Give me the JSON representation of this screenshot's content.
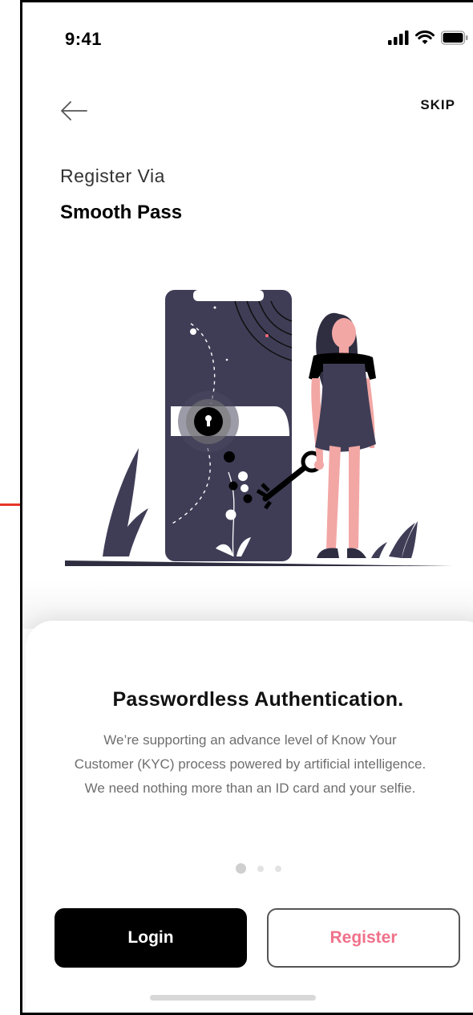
{
  "status_bar": {
    "time": "9:41",
    "icons": [
      "signal-icon",
      "wifi-icon",
      "battery-icon"
    ]
  },
  "header": {
    "back_icon": "back-arrow-icon",
    "skip_label": "SKIP"
  },
  "intro": {
    "subtitle": "Register Via",
    "title": "Smooth Pass"
  },
  "illustration": {
    "name": "phone-key-lock-illustration",
    "colors": {
      "phone": "#3f3d56",
      "skin": "#f2a7a5",
      "hair": "#2f2e41",
      "key": "#000000"
    }
  },
  "card": {
    "title": "Passwordless Authentication.",
    "body": "We’re supporting an advance level of Know Your Customer (KYC) process powered by artificial intelligence. We need nothing more than an ID card and your selfie.",
    "pagination": {
      "total": 3,
      "active": 1
    }
  },
  "actions": {
    "login_label": "Login",
    "register_label": "Register"
  },
  "colors": {
    "accent": "#f0718a",
    "primary_button": "#000000",
    "body_text": "#6e6e6e"
  }
}
